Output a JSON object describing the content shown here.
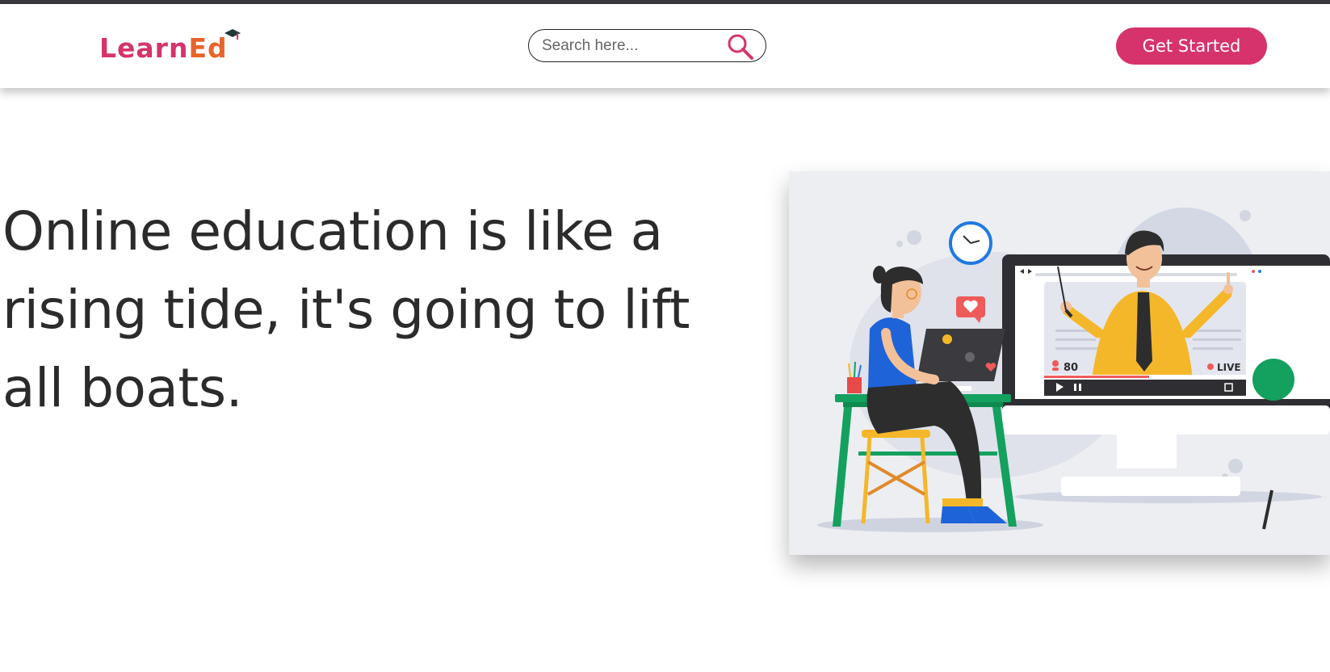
{
  "header": {
    "logo": {
      "text_main": "Learn",
      "text_accent": "Ed"
    },
    "search": {
      "placeholder": "Search here..."
    },
    "cta_label": "Get Started"
  },
  "hero": {
    "headline": "Online education is like a rising tide, it's going to lift all boats.",
    "illustration": {
      "viewer_count": "80",
      "live_label": "LIVE"
    }
  },
  "colors": {
    "brand": "#d6336c",
    "text": "#2b2b2b",
    "illustration_bg": "#eceef2"
  }
}
